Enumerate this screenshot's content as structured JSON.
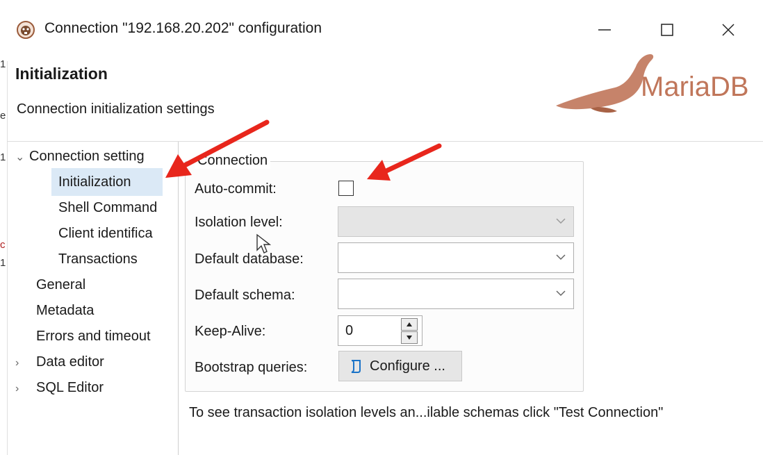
{
  "window": {
    "title": "Connection \"192.168.20.202\" configuration",
    "icon": "dbeaver-beaver-icon",
    "controls": [
      "minimize-icon",
      "maximize-icon",
      "close-icon"
    ]
  },
  "header": {
    "title": "Initialization",
    "description": "Connection initialization settings",
    "logo_text": "MariaDB",
    "logo_color": "#c0765a"
  },
  "left_edge_chars": [
    "1",
    "e",
    "1",
    "c",
    "1"
  ],
  "nav": {
    "items": [
      {
        "label": "Connection setting",
        "level": 0,
        "expanded": true
      },
      {
        "label": "Initialization",
        "level": 1,
        "selected": true
      },
      {
        "label": "Shell Command",
        "level": 1
      },
      {
        "label": "Client identifica",
        "level": 1
      },
      {
        "label": "Transactions",
        "level": 1
      },
      {
        "label": "General",
        "level": 0
      },
      {
        "label": "Metadata",
        "level": 0
      },
      {
        "label": "Errors and timeout",
        "level": 0
      },
      {
        "label": "Data editor",
        "level": 0,
        "collapsed": true
      },
      {
        "label": "SQL Editor",
        "level": 0,
        "collapsed": true
      }
    ],
    "selected_bg": "#dbe9f6"
  },
  "connection_group": {
    "legend": "Connection",
    "auto_commit_label": "Auto-commit:",
    "auto_commit_checked": false,
    "isolation_label": "Isolation level:",
    "isolation_value": "",
    "default_database_label": "Default database:",
    "default_database_value": "",
    "default_schema_label": "Default schema:",
    "default_schema_value": "",
    "keep_alive_label": "Keep-Alive:",
    "keep_alive_value": "0",
    "bootstrap_label": "Bootstrap queries:",
    "configure_button": "Configure ..."
  },
  "footer_note": "To see transaction isolation levels an...ilable schemas click \"Test Connection\"",
  "annotation_color": "#e8261c"
}
